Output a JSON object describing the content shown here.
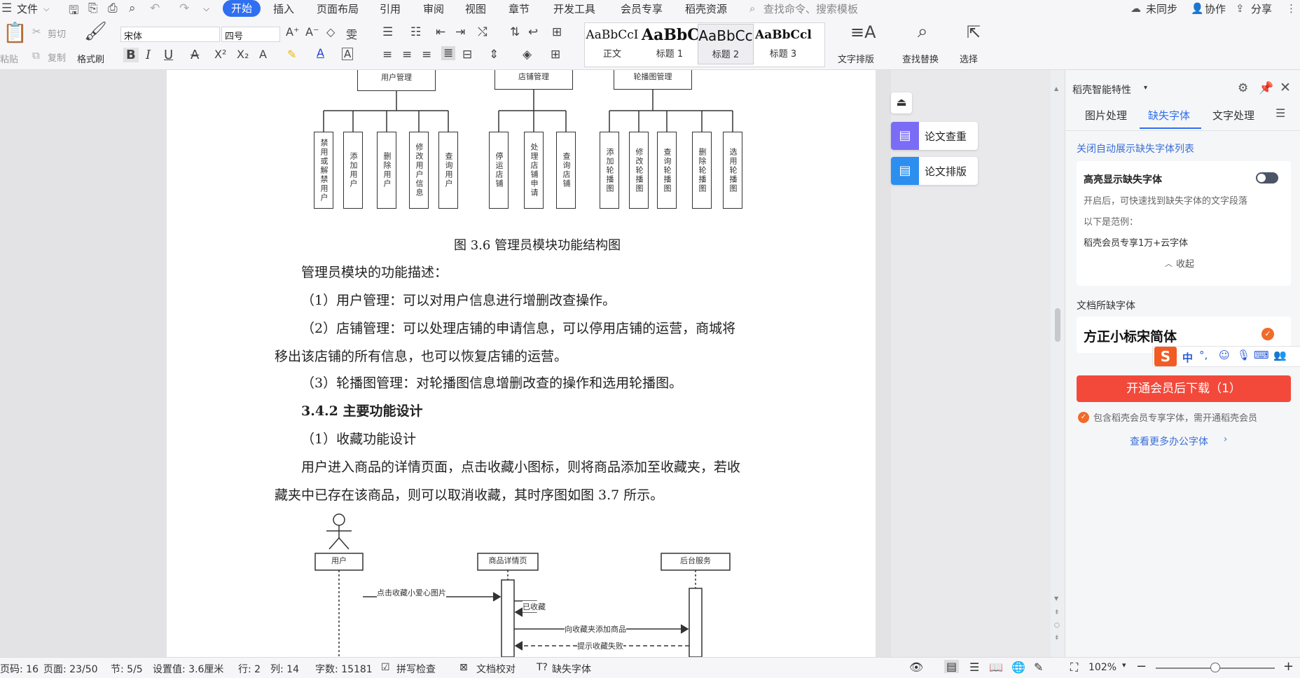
{
  "menubar": {
    "file_label": "文件",
    "tabs": [
      "开始",
      "插入",
      "页面布局",
      "引用",
      "审阅",
      "视图",
      "章节",
      "开发工具",
      "会员专享",
      "稻壳资源"
    ],
    "search_placeholder": "查找命令、搜索模板",
    "sync_label": "未同步",
    "collab_label": "协作",
    "share_label": "分享"
  },
  "ribbon": {
    "paste_label": "粘贴",
    "cut_label": "剪切",
    "copy_label": "复制",
    "format_painter_label": "格式刷",
    "font_name": "宋体",
    "font_size": "四号",
    "styles": [
      {
        "sample": "AaBbCcI",
        "label": "正文"
      },
      {
        "sample": "AaBbC",
        "label": "标题 1"
      },
      {
        "sample": "AaBbCc",
        "label": "标题 2"
      },
      {
        "sample": "AaBbCcl",
        "label": "标题 3"
      }
    ],
    "text_layout_label": "文字排版",
    "find_replace_label": "查找替换",
    "select_label": "选择"
  },
  "document": {
    "org_top_labels": [
      "用户管理",
      "店铺管理",
      "轮播图管理"
    ],
    "org_leaves_user": [
      "禁用或解禁用户",
      "添加用户",
      "删除用户",
      "修改用户信息",
      "查询用户"
    ],
    "org_leaves_shop": [
      "停运店铺",
      "处理店铺申请",
      "查询店铺"
    ],
    "org_leaves_banner": [
      "添加轮播图",
      "修改轮播图",
      "查询轮播图",
      "删除轮播图",
      "选用轮播图"
    ],
    "figure_caption": "图 3.6  管理员模块功能结构图",
    "para1": "管理员模块的功能描述：",
    "para2": "（1）用户管理：可以对用户信息进行增删改查操作。",
    "para3a": "（2）店铺管理：可以处理店铺的申请信息，可以停用店铺的运营，商城将",
    "para3b": "移出该店铺的所有信息，也可以恢复店铺的运营。",
    "para4": "（3）轮播图管理：对轮播图信息增删改查的操作和选用轮播图。",
    "heading": "3.4.2    主要功能设计",
    "para5": "（1）收藏功能设计",
    "para6a": "用户进入商品的详情页面，点击收藏小图标，则将商品添加至收藏夹，若收",
    "para6b": "藏夹中已存在该商品，则可以取消收藏，其时序图如图 3.7 所示。",
    "seq_actors": [
      "用户",
      "商品详情页",
      "后台服务"
    ],
    "seq_msgs": [
      "点击收藏小爱心图片",
      "已收藏",
      "向收藏夹添加商品",
      "提示收藏失败"
    ]
  },
  "floating": {
    "plagiarism_label": "论文查重",
    "layout_label": "论文排版"
  },
  "panel": {
    "title": "稻壳智能特性",
    "tabs": [
      "图片处理",
      "缺失字体",
      "文字处理"
    ],
    "close_auto_link": "关闭自动展示缺失字体列表",
    "highlight_title": "高亮显示缺失字体",
    "highlight_desc1": "开启后，可快速找到缺失字体的文字段落",
    "example_label": "以下是范例：",
    "example_value": "稻壳会员专享1万+云字体",
    "collapse_label": "收起",
    "missing_fonts_heading": "文档所缺字体",
    "missing_font": "方正小标宋简体",
    "ime_label": "中",
    "download_button": "开通会员后下载（1）",
    "member_note": "包含稻壳会员专享字体，需开通稻壳会员",
    "more_fonts_link": "查看更多办公字体"
  },
  "statusbar": {
    "page_code": "页码: 16",
    "page": "页面: 23/50",
    "section": "节: 5/5",
    "setting": "设置值: 3.6厘米",
    "row": "行: 2",
    "col": "列: 14",
    "word_count": "字数: 15181",
    "spell_check": "拼写检查",
    "doc_proof": "文档校对",
    "missing_font": "缺失字体",
    "zoom": "102%"
  },
  "colors": {
    "accent": "#2f6ff0",
    "download_red": "#f2493b",
    "link_blue": "#3a6fd8"
  }
}
